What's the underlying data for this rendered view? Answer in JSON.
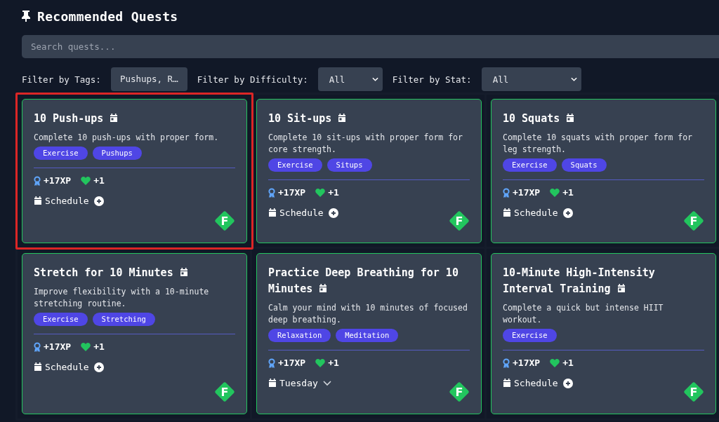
{
  "header": {
    "title": "Recommended Quests"
  },
  "search": {
    "placeholder": "Search quests..."
  },
  "filters": [
    {
      "label": "Filter by Tags:",
      "kind": "tags",
      "value": "Pushups, R…"
    },
    {
      "label": "Filter by Difficulty:",
      "kind": "select",
      "value": "All"
    },
    {
      "label": "Filter by Stat:",
      "kind": "select",
      "value": "All"
    }
  ],
  "quests": [
    {
      "title": "10 Push-ups",
      "description": "Complete 10 push-ups with proper form.",
      "tags": [
        "Exercise",
        "Pushups"
      ],
      "xp": "+17XP",
      "stat": "+1",
      "schedule": {
        "kind": "add",
        "label": "Schedule"
      },
      "grade": "F",
      "selected": true
    },
    {
      "title": "10 Sit-ups",
      "description": "Complete 10 sit-ups with proper form for core strength.",
      "tags": [
        "Exercise",
        "Situps"
      ],
      "xp": "+17XP",
      "stat": "+1",
      "schedule": {
        "kind": "add",
        "label": "Schedule"
      },
      "grade": "F",
      "selected": false
    },
    {
      "title": "10 Squats",
      "description": "Complete 10 squats with proper form for leg strength.",
      "tags": [
        "Exercise",
        "Squats"
      ],
      "xp": "+17XP",
      "stat": "+1",
      "schedule": {
        "kind": "add",
        "label": "Schedule"
      },
      "grade": "F",
      "selected": false
    },
    {
      "title": "Stretch for 10 Minutes",
      "description": "Improve flexibility with a 10-minute stretching routine.",
      "tags": [
        "Exercise",
        "Stretching"
      ],
      "xp": "+17XP",
      "stat": "+1",
      "schedule": {
        "kind": "add",
        "label": "Schedule"
      },
      "grade": "F",
      "selected": false
    },
    {
      "title": "Practice Deep Breathing for 10 Minutes",
      "description": "Calm your mind with 10 minutes of focused deep breathing.",
      "tags": [
        "Relaxation",
        "Meditation"
      ],
      "xp": "+17XP",
      "stat": "+1",
      "schedule": {
        "kind": "day",
        "label": "Tuesday"
      },
      "grade": "F",
      "selected": false
    },
    {
      "title": "10-Minute High-Intensity Interval Training",
      "description": "Complete a quick but intense HIIT workout.",
      "tags": [
        "Exercise"
      ],
      "xp": "+17XP",
      "stat": "+1",
      "schedule": {
        "kind": "add",
        "label": "Schedule"
      },
      "grade": "F",
      "selected": false
    }
  ]
}
